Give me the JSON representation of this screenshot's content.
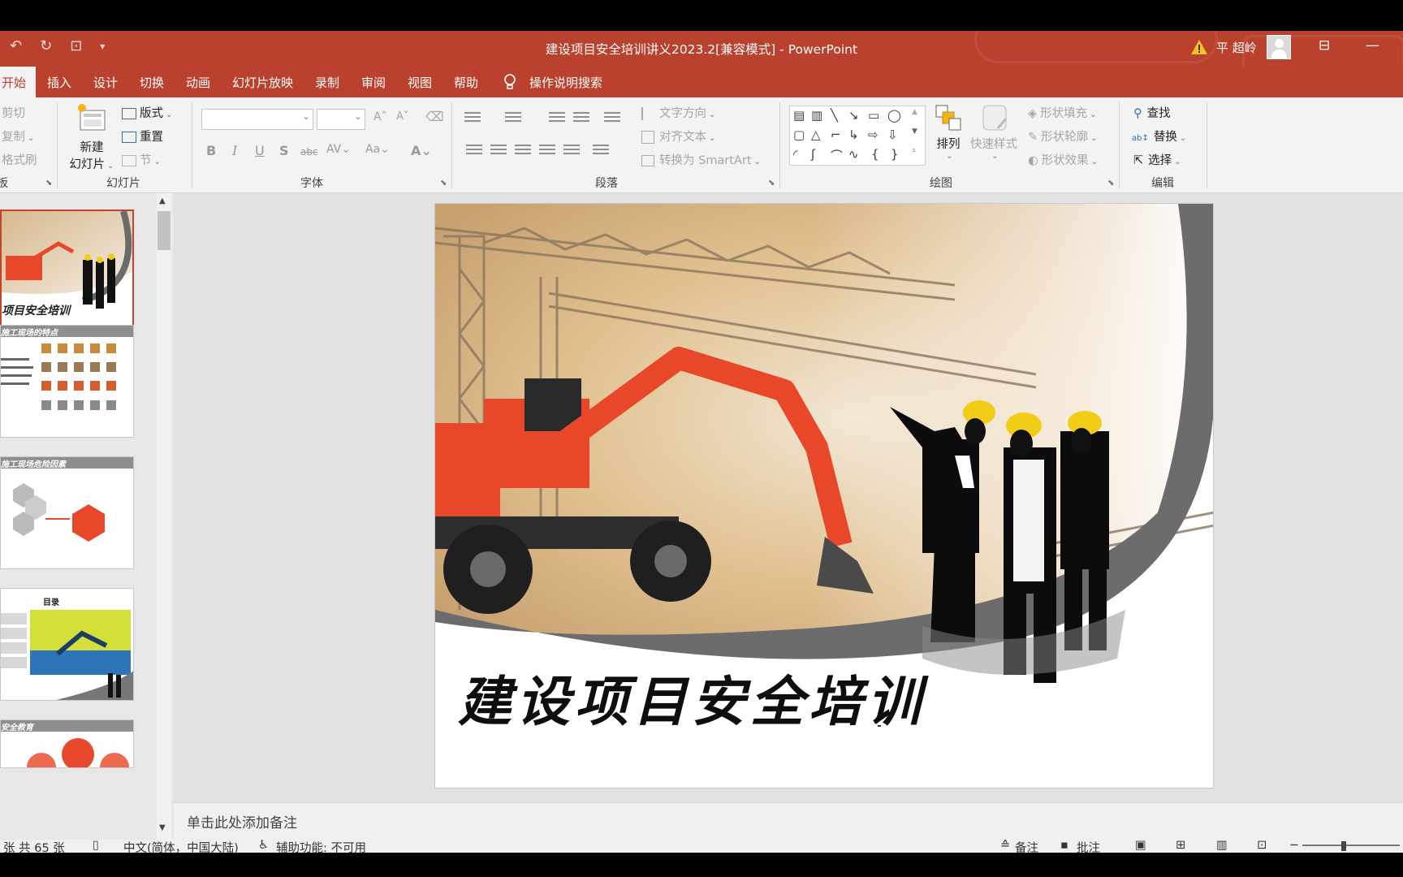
{
  "window": {
    "title": "建设项目安全培训讲义2023.2[兼容模式]  -  PowerPoint",
    "user": "平 超岭"
  },
  "tabs": [
    "开始",
    "插入",
    "设计",
    "切换",
    "动画",
    "幻灯片放映",
    "录制",
    "审阅",
    "视图",
    "帮助"
  ],
  "tell_me": "操作说明搜索",
  "ribbon": {
    "clipboard": {
      "cut": "剪切",
      "copy": "复制",
      "format_painter": "格式刷",
      "label": "板"
    },
    "slides": {
      "new_slide_l1": "新建",
      "new_slide_l2": "幻灯片",
      "layout": "版式",
      "reset": "重置",
      "section": "节",
      "label": "幻灯片"
    },
    "font": {
      "label": "字体"
    },
    "paragraph": {
      "text_direction": "文字方向",
      "align_text": "对齐文本",
      "smartart": "转换为 SmartArt",
      "label": "段落"
    },
    "drawing": {
      "arrange": "排列",
      "quick_styles": "快速样式",
      "shape_fill": "形状填充",
      "shape_outline": "形状轮廓",
      "shape_effects": "形状效果",
      "label": "绘图"
    },
    "editing": {
      "find": "查找",
      "replace": "替换",
      "select": "选择",
      "label": "编辑"
    }
  },
  "thumbnails": [
    {
      "caption": "项目安全培训"
    },
    {
      "caption": "施工现场的特点"
    },
    {
      "caption": "施工现场危险因素"
    },
    {
      "caption": "目录"
    },
    {
      "caption": "安全教育"
    }
  ],
  "slide": {
    "title": "建设项目安全培训"
  },
  "notes_placeholder": "单击此处添加备注",
  "statusbar": {
    "slide_count": "张  共 65 张",
    "language": "中文(简体，中国大陆)",
    "accessibility": "辅助功能: 不可用",
    "notes": "备注",
    "comments": "批注"
  },
  "colors": {
    "accent": "#b9412d",
    "ribbon_bg": "#f3f3f3",
    "excavator": "#e8472a",
    "helmet": "#f3cc16"
  }
}
